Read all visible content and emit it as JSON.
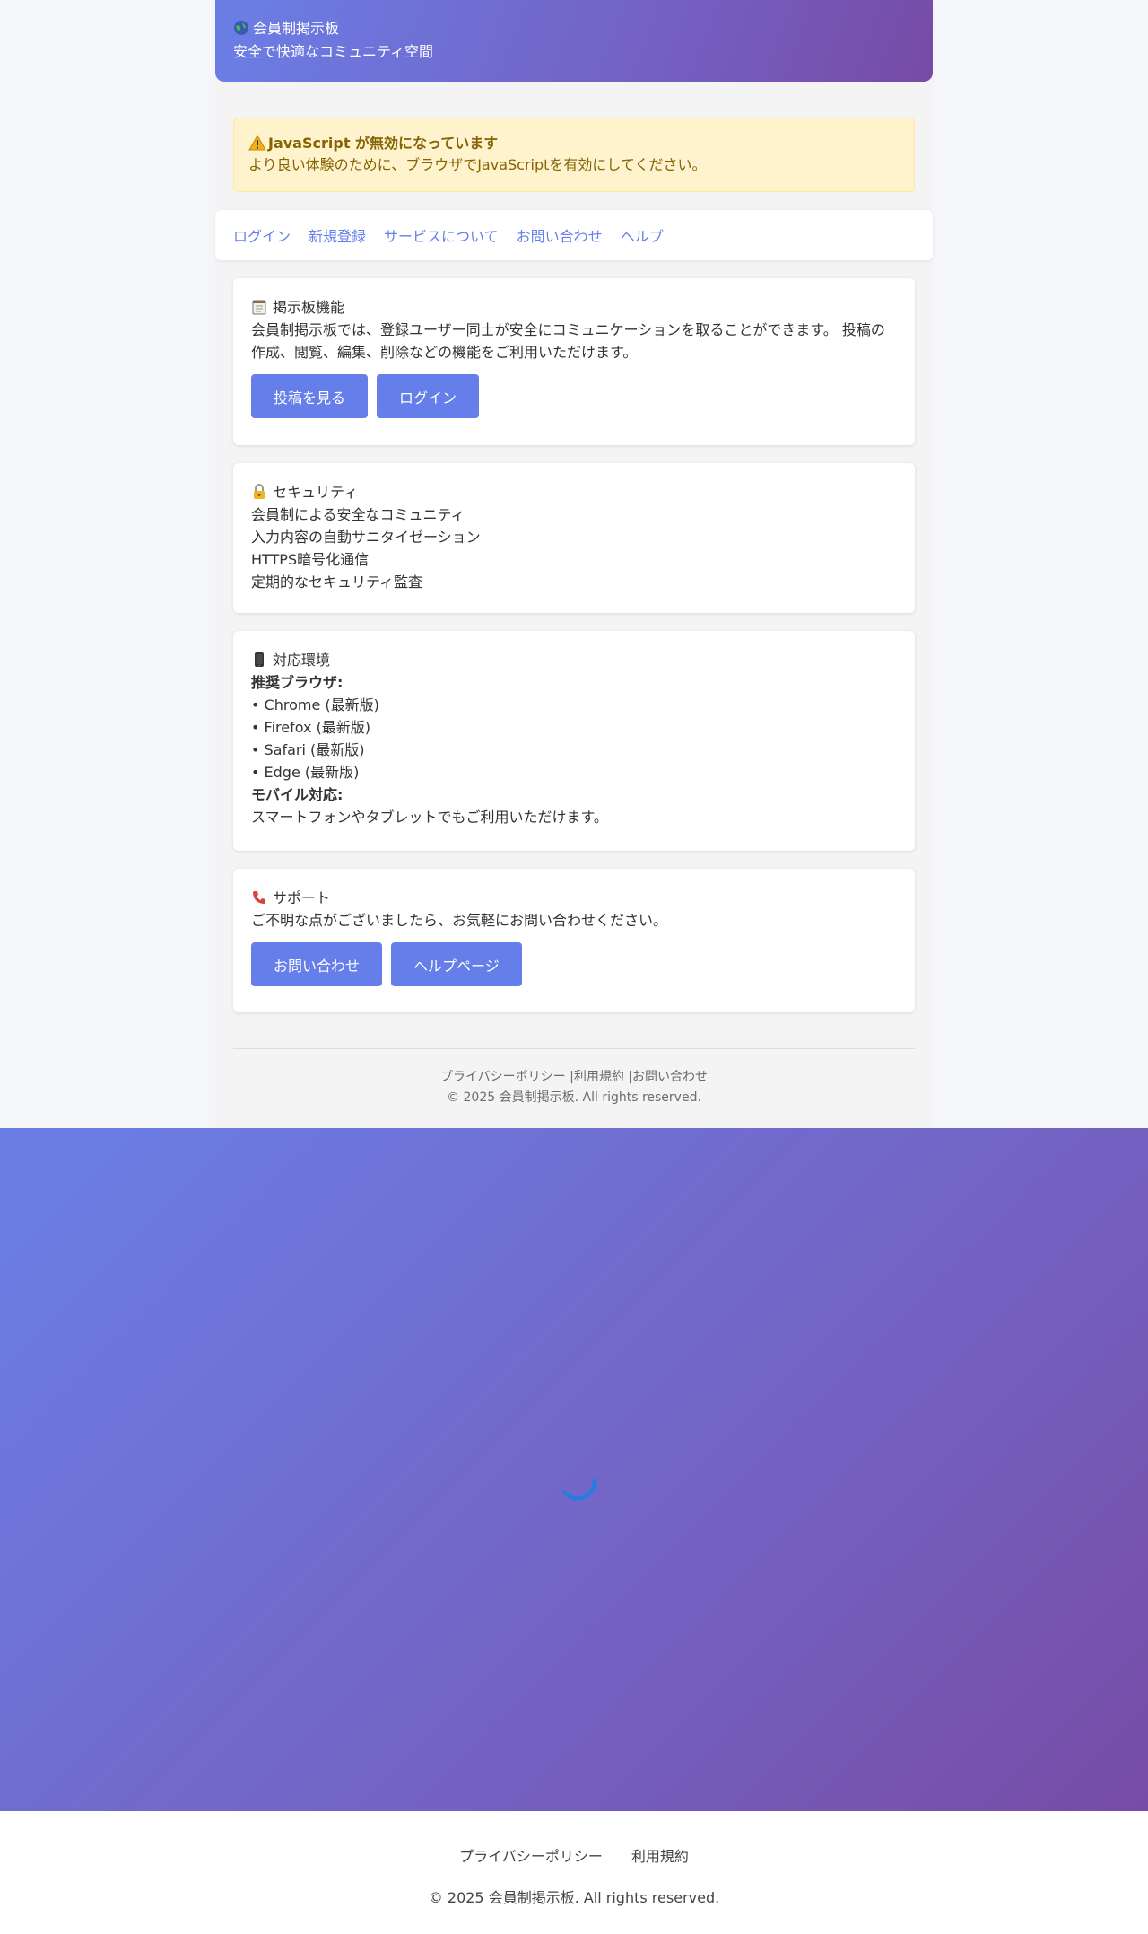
{
  "header": {
    "title": "会員制掲示板",
    "subtitle": "安全で快適なコミュニティ空間"
  },
  "warning": {
    "title": "JavaScript が無効になっています",
    "text": "より良い体験のために、ブラウザでJavaScriptを有効にしてください。"
  },
  "nav": {
    "items": [
      "ログイン",
      "新規登録",
      "サービスについて",
      "お問い合わせ",
      "ヘルプ"
    ]
  },
  "board": {
    "title": "掲示板機能",
    "line1": "会員制掲示板では、登録ユーザー同士が安全にコミュニケーションを取ることができます。 投稿の",
    "line2": "作成、閲覧、編集、削除などの機能をご利用いただけます。",
    "buttons": [
      "投稿を見る",
      "ログイン"
    ]
  },
  "security": {
    "title": "セキュリティ",
    "items": [
      "会員制による安全なコミュニティ",
      "入力内容の自動サニタイゼーション",
      "HTTPS暗号化通信",
      "定期的なセキュリティ監査"
    ]
  },
  "env": {
    "title": "対応環境",
    "browsers_label": "推奨ブラウザ:",
    "browsers": [
      "• Chrome (最新版)",
      "• Firefox (最新版)",
      "• Safari (最新版)",
      "• Edge (最新版)"
    ],
    "mobile_label": "モバイル対応:",
    "mobile_text": "スマートフォンやタブレットでもご利用いただけます。"
  },
  "support": {
    "title": "サポート",
    "text": "ご不明な点がございましたら、お気軽にお問い合わせください。",
    "buttons": [
      "お問い合わせ",
      "ヘルプページ"
    ]
  },
  "footer": {
    "privacy": "プライバシーポリシー",
    "sep1": " |",
    "terms": "利用規約",
    "sep2": " |",
    "contact": "お問い合わせ",
    "copyright": "© 2025 会員制掲示板. All rights reserved."
  },
  "page_footer": {
    "privacy": "プライバシーポリシー",
    "terms": "利用規約",
    "copyright": "© 2025 会員制掲示板. All rights reserved."
  },
  "colors": {
    "accent": "#667eea",
    "gradient_start": "#6a7fe6",
    "gradient_end": "#774ba6",
    "warning_bg": "#fff3cd",
    "warning_text": "#856404",
    "spinner": "#1f7fe0"
  },
  "icons": {
    "header": "globe-speech-icon",
    "warning": "warning-icon",
    "board": "notepad-icon",
    "security": "lock-key-icon",
    "env": "mobile-phone-icon",
    "support": "telephone-icon",
    "loading": "spinner-icon"
  }
}
